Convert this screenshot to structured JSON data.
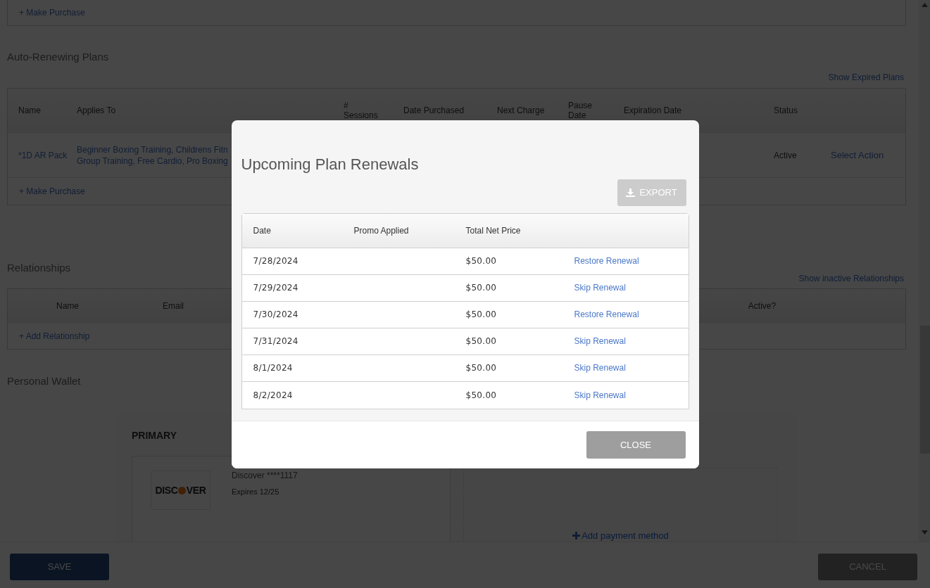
{
  "purchases_card": {
    "add_link": "+ Make Purchase"
  },
  "auto_renewing": {
    "title": "Auto-Renewing Plans",
    "toggle_link": "Show Expired Plans",
    "columns": [
      "Name",
      "Applies To",
      "# Sessions",
      "Date Purchased",
      "Next Charge",
      "Pause Date",
      "Expiration Date",
      "Status"
    ],
    "rows": [
      {
        "name": "*1D AR Pack",
        "applies_to": [
          "Beginner Boxing Training, Childrens Fitn",
          "Group Training, Free Cardio, Pro Boxing"
        ],
        "status": "Active",
        "action": "Select Action"
      }
    ],
    "add_link": "+ Make Purchase"
  },
  "relationships": {
    "title": "Relationships",
    "toggle_link": "Show inactive Relationships",
    "columns": [
      "Name",
      "Email",
      "Active?"
    ],
    "add_link": "+ Add Relationship"
  },
  "wallet": {
    "title": "Personal Wallet",
    "primary_label": "PRIMARY",
    "card": {
      "logo": "DISC",
      "logo_end": "VER",
      "number": "Discover ****1117",
      "expires": "Expires 12/25"
    },
    "add_payment": "Add payment method"
  },
  "footer": {
    "save": "SAVE",
    "cancel": "CANCEL"
  },
  "modal": {
    "title": "Upcoming Plan Renewals",
    "export": "EXPORT",
    "columns": [
      "Date",
      "Promo Applied",
      "Total Net Price"
    ],
    "rows": [
      {
        "date": "7/28/2024",
        "price": "$50.00",
        "action": "Restore Renewal"
      },
      {
        "date": "7/29/2024",
        "price": "$50.00",
        "action": "Skip Renewal"
      },
      {
        "date": "7/30/2024",
        "price": "$50.00",
        "action": "Restore Renewal"
      },
      {
        "date": "7/31/2024",
        "price": "$50.00",
        "action": "Skip Renewal"
      },
      {
        "date": "8/1/2024",
        "price": "$50.00",
        "action": "Skip Renewal"
      },
      {
        "date": "8/2/2024",
        "price": "$50.00",
        "action": "Skip Renewal"
      }
    ],
    "close": "CLOSE"
  }
}
